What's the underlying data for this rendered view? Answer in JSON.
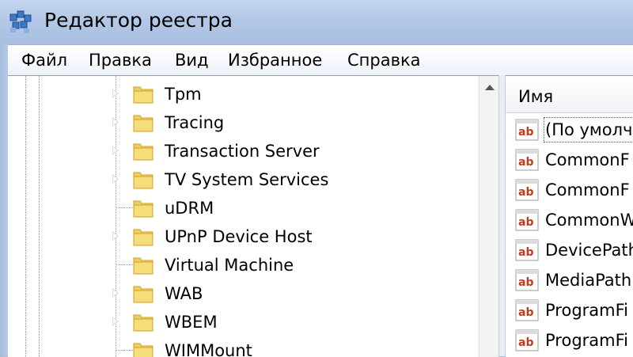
{
  "window": {
    "title": "Редактор реестра",
    "app_icon": "registry-editor-icon"
  },
  "menu": [
    "Файл",
    "Правка",
    "Вид",
    "Избранное",
    "Справка"
  ],
  "tree": {
    "items": [
      {
        "label": "Tpm",
        "expandable": true
      },
      {
        "label": "Tracing",
        "expandable": true
      },
      {
        "label": "Transaction Server",
        "expandable": true
      },
      {
        "label": "TV System Services",
        "expandable": true
      },
      {
        "label": "uDRM",
        "expandable": false
      },
      {
        "label": "UPnP Device Host",
        "expandable": true
      },
      {
        "label": "Virtual Machine",
        "expandable": false
      },
      {
        "label": "WAB",
        "expandable": true
      },
      {
        "label": "WBEM",
        "expandable": true
      },
      {
        "label": "WIMMount",
        "expandable": false
      }
    ]
  },
  "values": {
    "column_header": "Имя",
    "items": [
      {
        "name": "(По умолч",
        "type_icon": "string-value-icon"
      },
      {
        "name": "CommonF",
        "type_icon": "string-value-icon"
      },
      {
        "name": "CommonF",
        "type_icon": "string-value-icon"
      },
      {
        "name": "CommonW",
        "type_icon": "string-value-icon"
      },
      {
        "name": "DevicePath",
        "type_icon": "string-value-icon"
      },
      {
        "name": "MediaPath",
        "type_icon": "string-value-icon"
      },
      {
        "name": "ProgramFi",
        "type_icon": "string-value-icon"
      },
      {
        "name": "ProgramFi",
        "type_icon": "string-value-icon"
      }
    ]
  },
  "colors": {
    "folder": "#f2cf5b",
    "folder_edge": "#c9a02f",
    "ab_text": "#c43a1a",
    "title_bar": "#b3c8e6"
  }
}
